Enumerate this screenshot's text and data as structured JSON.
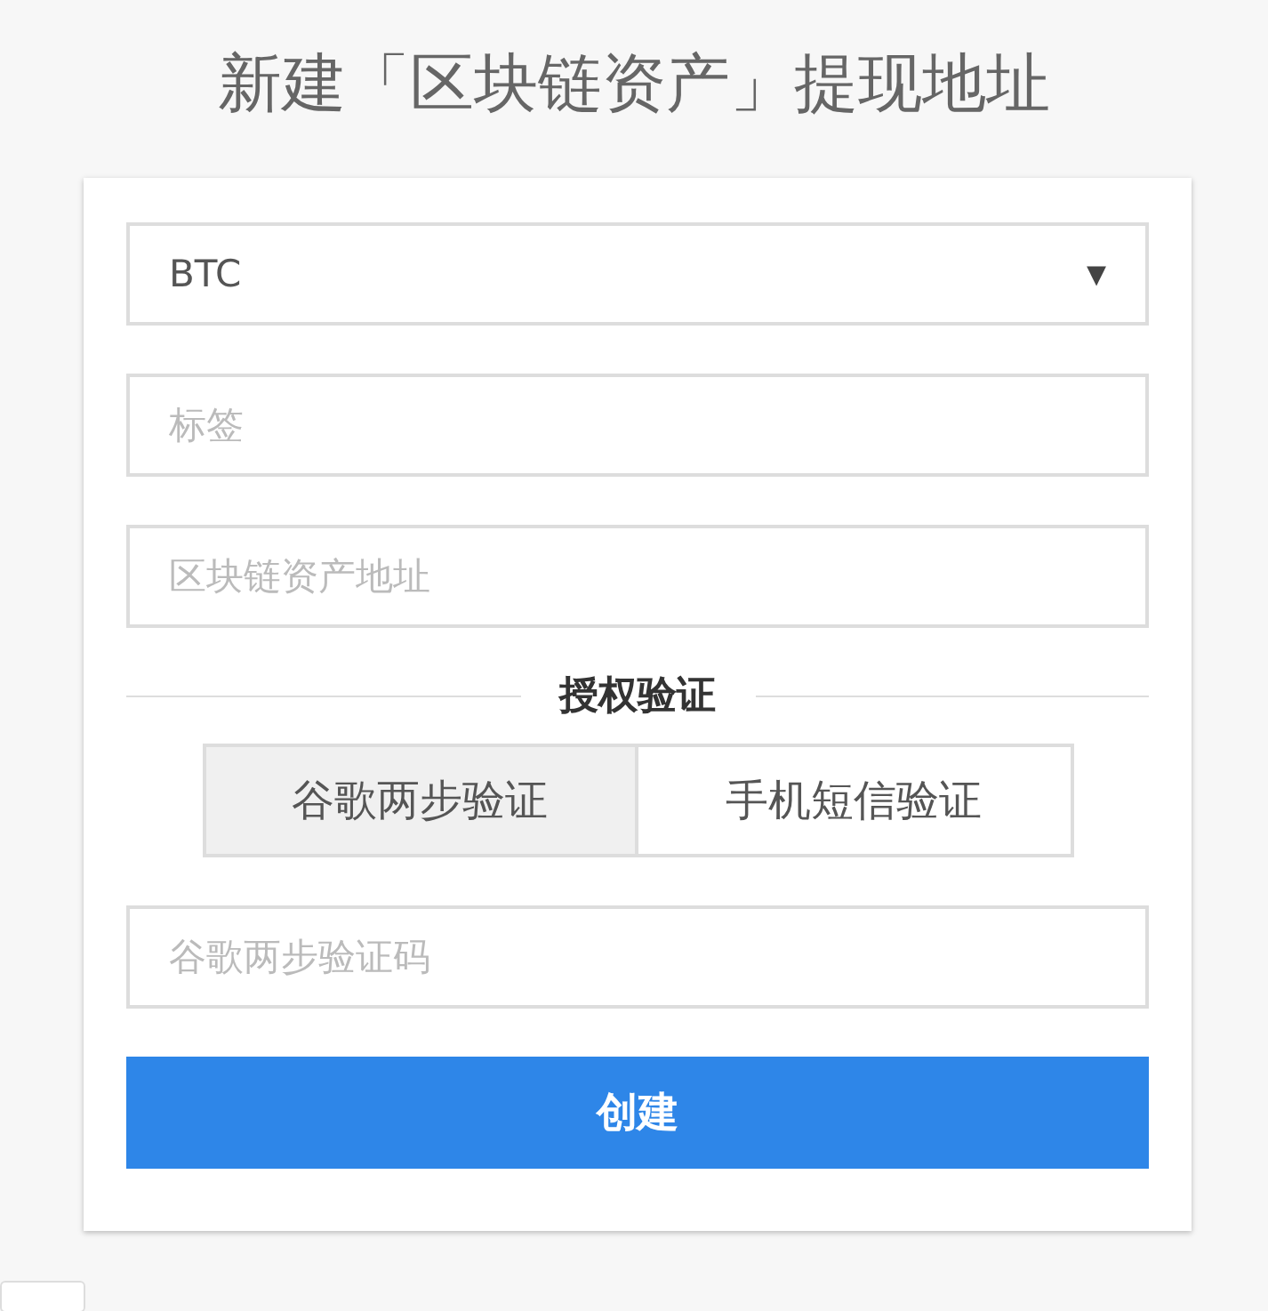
{
  "title": "新建「区块链资产」提现地址",
  "form": {
    "asset_select": {
      "value": "BTC",
      "caret": "▾"
    },
    "label_field": {
      "placeholder": "标签"
    },
    "address_field": {
      "placeholder": "区块链资产地址"
    },
    "section_heading": "授权验证",
    "tabs": [
      {
        "label": "谷歌两步验证",
        "selected": true
      },
      {
        "label": "手机短信验证",
        "selected": false
      }
    ],
    "code_field": {
      "placeholder": "谷歌两步验证码"
    },
    "submit": "创建"
  }
}
